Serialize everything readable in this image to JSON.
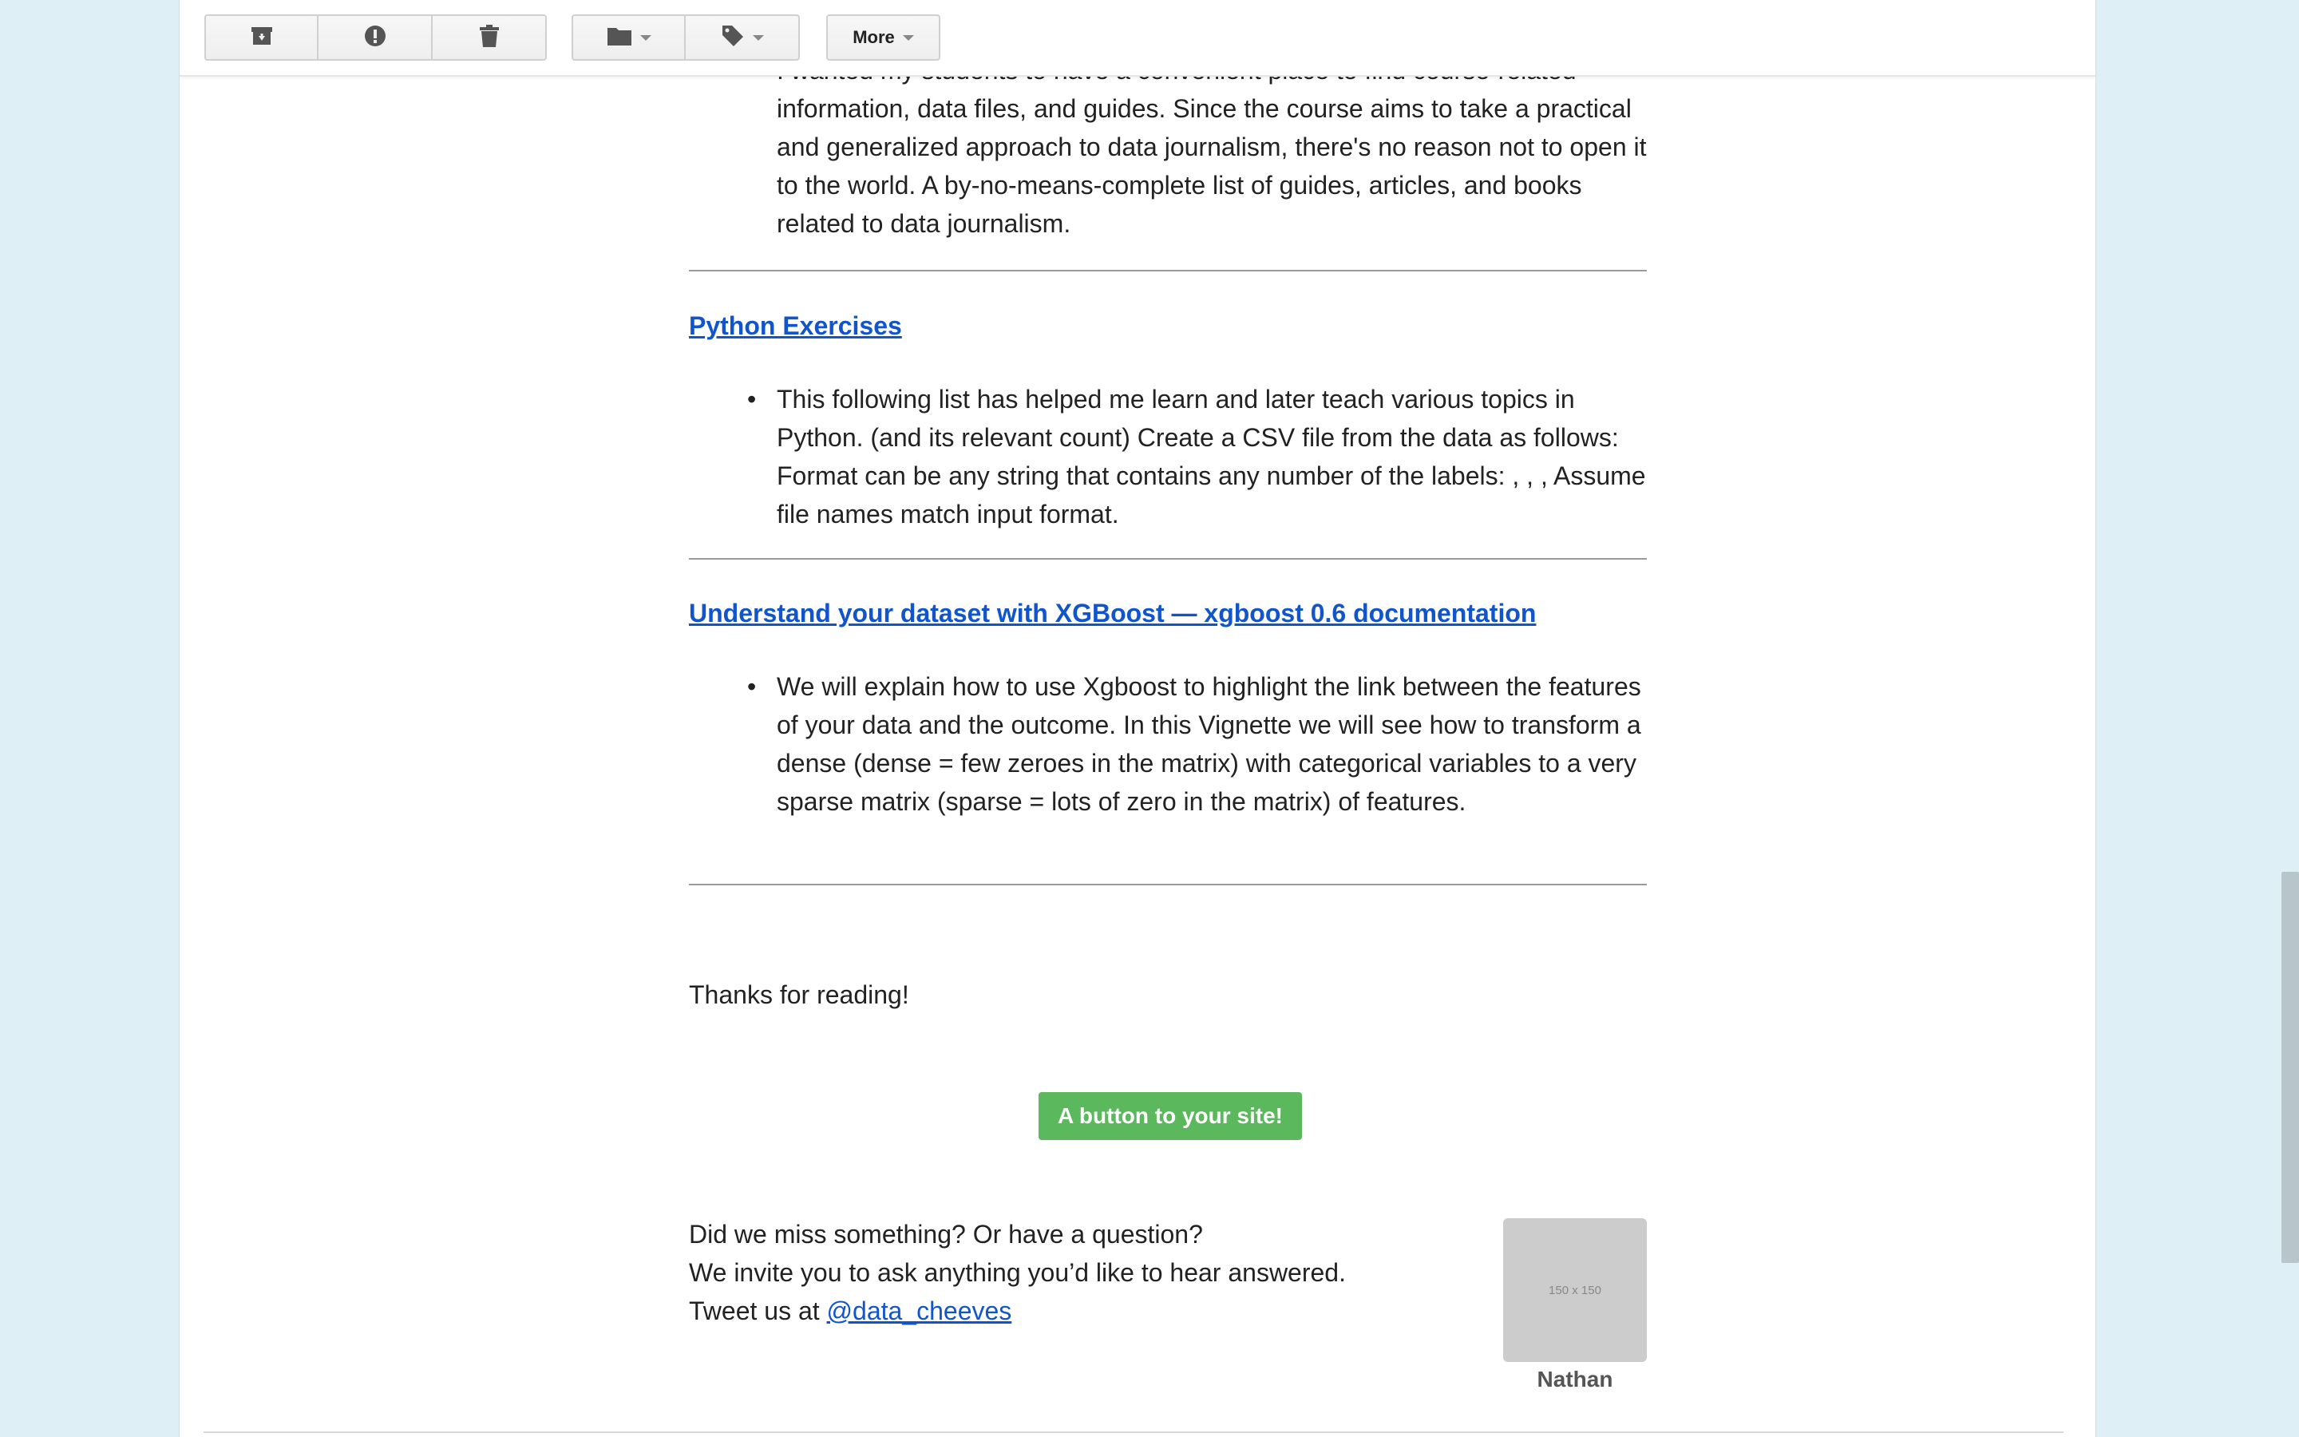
{
  "toolbar": {
    "more_label": "More"
  },
  "content": {
    "intro_text": "I wanted my students to have a convenient place to find course-related information, data files, and guides. Since the course aims to take a practical and generalized approach to data journalism, there's no reason not to open it to the world. A by-no-means-complete list of guides, articles, and books related to data journalism.",
    "sections": [
      {
        "heading": "Python Exercises",
        "bullet": "This following list has helped me learn and later teach various topics in Python. (and its relevant count) Create a CSV file from the data as follows: Format can be any string that contains any number of the labels: , , , Assume file names match input format."
      },
      {
        "heading": "Understand your dataset with XGBoost — xgboost 0.6 documentation",
        "bullet": "We will explain how to use Xgboost to highlight the link between the features of your data and the outcome. In this Vignette we will see how to transform a dense (dense = few zeroes in the matrix) with categorical variables to a very sparse matrix (sparse = lots of zero in the matrix) of features."
      }
    ],
    "thanks": "Thanks for reading!",
    "cta_label": "A button to your site!",
    "footer": {
      "line1": "Did we miss something? Or have a question?",
      "line2": "We invite you to ask anything you’d like to hear answered.",
      "line3_prefix": "Tweet us at ",
      "handle": "@data_cheeves"
    },
    "avatar": {
      "placeholder": "150 x 150",
      "name": "Nathan"
    }
  }
}
